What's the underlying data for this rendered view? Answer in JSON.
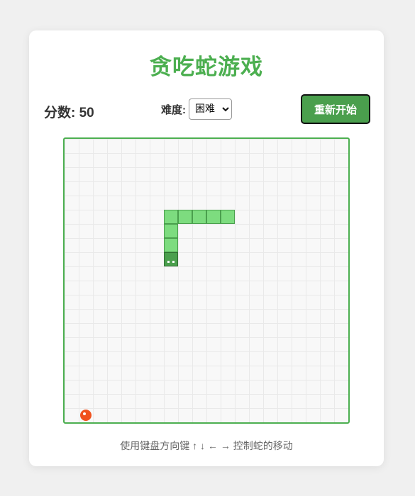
{
  "title": "贪吃蛇游戏",
  "score": {
    "label": "分数:",
    "value": "50"
  },
  "difficulty": {
    "label": "难度:",
    "selected": "困难",
    "options": [
      "困难"
    ]
  },
  "restart_label": "重新开始",
  "hint": "使用键盘方向键 ↑ ↓ ← → 控制蛇的移动",
  "board": {
    "columns": 20,
    "rows": 20,
    "snake": [
      {
        "col": 7,
        "row": 8
      },
      {
        "col": 7,
        "row": 7
      },
      {
        "col": 7,
        "row": 6
      },
      {
        "col": 7,
        "row": 5
      },
      {
        "col": 8,
        "row": 5
      },
      {
        "col": 9,
        "row": 5
      },
      {
        "col": 10,
        "row": 5
      },
      {
        "col": 11,
        "row": 5
      }
    ],
    "direction": "down",
    "food": {
      "col": 1,
      "row": 19
    }
  },
  "colors": {
    "accent": "#4caf50",
    "snake_body": "#7ddc7f",
    "snake_head": "#4a9f4d",
    "food": "#f0521e",
    "restart_button": "#4a9f4d"
  }
}
